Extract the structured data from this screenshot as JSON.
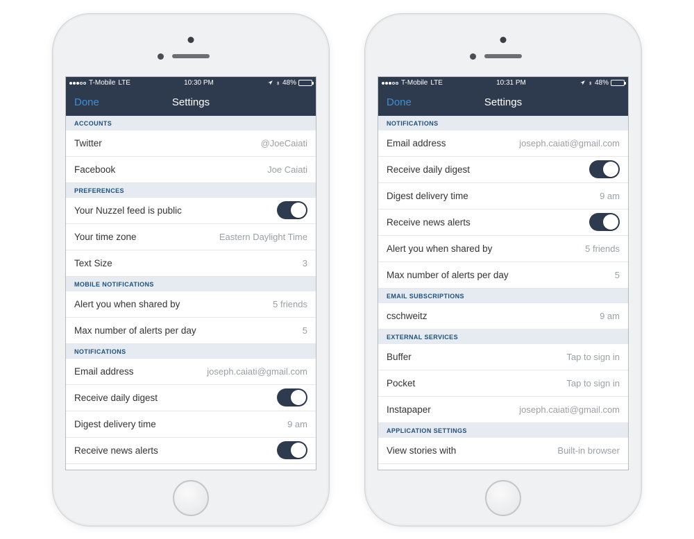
{
  "phones": [
    {
      "status": {
        "carrier": "T-Mobile",
        "network": "LTE",
        "time": "10:30 PM",
        "battery_pct": "48%"
      },
      "nav": {
        "left": "Done",
        "title": "Settings"
      },
      "sections": [
        {
          "header": "ACCOUNTS",
          "rows": [
            {
              "label": "Twitter",
              "value": "@JoeCaiati",
              "type": "text"
            },
            {
              "label": "Facebook",
              "value": "Joe Caiati",
              "type": "text"
            }
          ]
        },
        {
          "header": "PREFERENCES",
          "rows": [
            {
              "label": "Your Nuzzel feed is public",
              "type": "toggle",
              "on": true
            },
            {
              "label": "Your time zone",
              "value": "Eastern Daylight Time",
              "type": "text"
            },
            {
              "label": "Text Size",
              "value": "3",
              "type": "text"
            }
          ]
        },
        {
          "header": "MOBILE NOTIFICATIONS",
          "rows": [
            {
              "label": "Alert you when shared by",
              "value": "5 friends",
              "type": "text"
            },
            {
              "label": "Max number of alerts per day",
              "value": "5",
              "type": "text"
            }
          ]
        },
        {
          "header": "NOTIFICATIONS",
          "rows": [
            {
              "label": "Email address",
              "value": "joseph.caiati@gmail.com",
              "type": "text"
            },
            {
              "label": "Receive daily digest",
              "type": "toggle",
              "on": true
            },
            {
              "label": "Digest delivery time",
              "value": "9 am",
              "type": "text"
            },
            {
              "label": "Receive news alerts",
              "type": "toggle",
              "on": true
            }
          ]
        }
      ]
    },
    {
      "status": {
        "carrier": "T-Mobile",
        "network": "LTE",
        "time": "10:31 PM",
        "battery_pct": "48%"
      },
      "nav": {
        "left": "Done",
        "title": "Settings"
      },
      "sections": [
        {
          "header": "NOTIFICATIONS",
          "rows": [
            {
              "label": "Email address",
              "value": "joseph.caiati@gmail.com",
              "type": "text"
            },
            {
              "label": "Receive daily digest",
              "type": "toggle",
              "on": true
            },
            {
              "label": "Digest delivery time",
              "value": "9 am",
              "type": "text"
            },
            {
              "label": "Receive news alerts",
              "type": "toggle",
              "on": true
            },
            {
              "label": "Alert you when shared by",
              "value": "5 friends",
              "type": "text"
            },
            {
              "label": "Max number of alerts per day",
              "value": "5",
              "type": "text"
            }
          ]
        },
        {
          "header": "EMAIL SUBSCRIPTIONS",
          "rows": [
            {
              "label": "cschweitz",
              "value": "9 am",
              "type": "text"
            }
          ]
        },
        {
          "header": "EXTERNAL SERVICES",
          "rows": [
            {
              "label": "Buffer",
              "value": "Tap to sign in",
              "type": "text"
            },
            {
              "label": "Pocket",
              "value": "Tap to sign in",
              "type": "text"
            },
            {
              "label": "Instapaper",
              "value": "joseph.caiati@gmail.com",
              "type": "text"
            }
          ]
        },
        {
          "header": "APPLICATION SETTINGS",
          "rows": [
            {
              "label": "View stories with",
              "value": "Built-in browser",
              "type": "text"
            }
          ]
        }
      ]
    }
  ]
}
